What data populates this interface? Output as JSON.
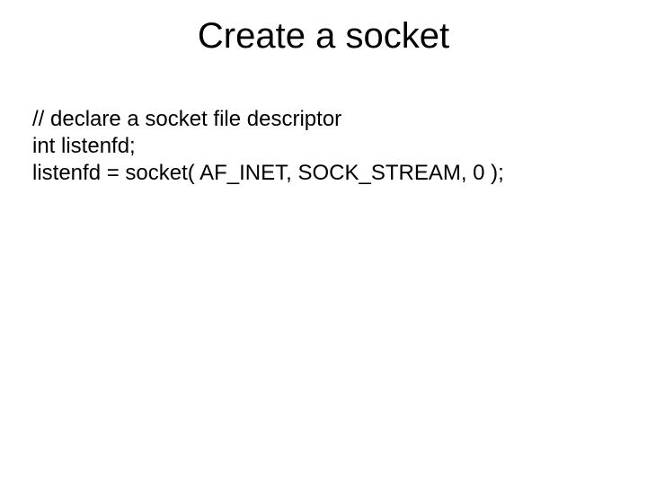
{
  "slide": {
    "title": "Create a socket",
    "lines": [
      "// declare a socket file descriptor",
      "int listenfd;",
      "listenfd = socket( AF_INET, SOCK_STREAM, 0 );"
    ]
  }
}
